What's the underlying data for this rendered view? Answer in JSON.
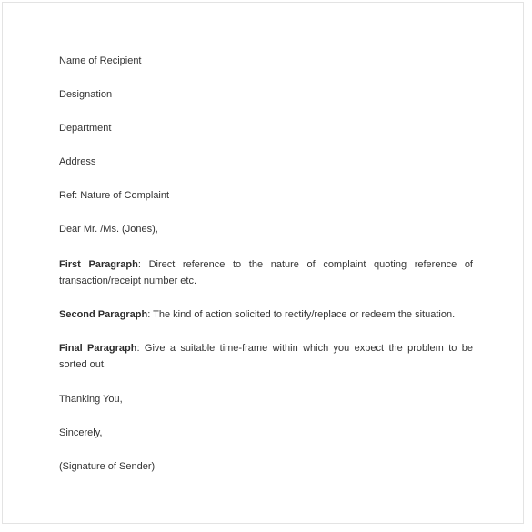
{
  "document": {
    "type": "complaint-letter-template",
    "background_color": "#ffffff",
    "border_color": "#e3e3e3",
    "text_color": "#333333"
  },
  "heading_block": {
    "recipient_name": "Name of Recipient",
    "designation": "Designation",
    "department": "Department",
    "address": "Address",
    "reference": "Ref: Nature of Complaint",
    "salutation": "Dear Mr. /Ms. (Jones),"
  },
  "paragraphs": [
    {
      "label": "First Paragraph",
      "separator": ": ",
      "text": "Direct reference to the nature of complaint quoting reference of transaction/receipt number etc."
    },
    {
      "label": "Second Paragraph",
      "separator": ": ",
      "text": "The kind of action solicited to rectify/replace or redeem the situation."
    },
    {
      "label": "Final Paragraph",
      "separator": ": ",
      "text": "Give a suitable time-frame within which you expect the problem to be sorted out."
    }
  ],
  "closing": {
    "thanks": "Thanking You,",
    "sign_off": "Sincerely,",
    "signature": "(Signature of Sender)"
  }
}
